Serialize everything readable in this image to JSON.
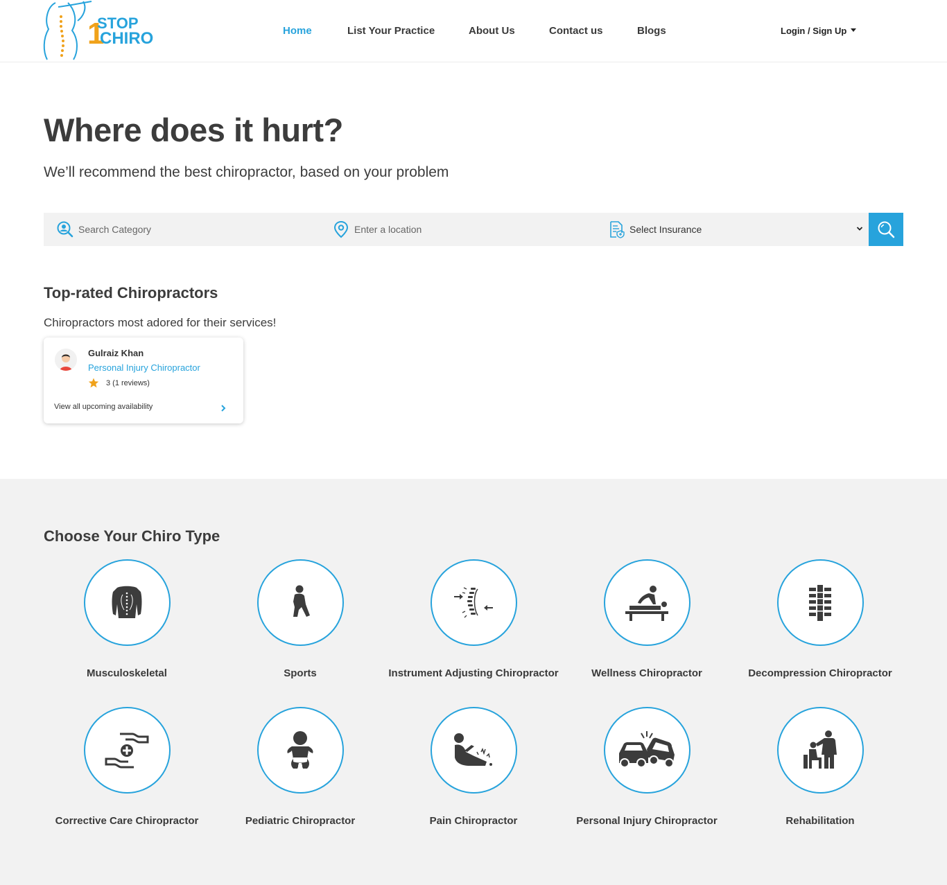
{
  "brand": {
    "logo_top": "STOP",
    "logo_bottom": "CHIRO",
    "logo_num": "1"
  },
  "nav": {
    "home": "Home",
    "list_practice": "List Your Practice",
    "about": "About Us",
    "contact": "Contact us",
    "blogs": "Blogs",
    "login": "Login / Sign Up"
  },
  "hero": {
    "title": "Where does it hurt?",
    "subtitle": "We’ll recommend the best chiropractor, based on your problem"
  },
  "search": {
    "category_placeholder": "Search Category",
    "location_placeholder": "Enter a location",
    "insurance_selected": "Select Insurance"
  },
  "top_rated": {
    "title": "Top-rated Chiropractors",
    "subtitle": "Chiropractors most adored for their services!",
    "cards": [
      {
        "name": "Gulraiz Khan",
        "specialty": "Personal Injury Chiropractor",
        "rating": "3 (1 reviews)",
        "availability": "View all upcoming availability"
      }
    ]
  },
  "chiro_types": {
    "title": "Choose Your Chiro Type",
    "items": [
      {
        "label": "Musculoskeletal",
        "icon": "back-muscles-icon"
      },
      {
        "label": "Sports",
        "icon": "athlete-icon"
      },
      {
        "label": "Instrument Adjusting Chiropractor",
        "icon": "spine-adjust-icon"
      },
      {
        "label": "Wellness Chiropractor",
        "icon": "massage-table-icon"
      },
      {
        "label": "Decompression Chiropractor",
        "icon": "spine-column-icon"
      },
      {
        "label": "Corrective Care Chiropractor",
        "icon": "care-hands-icon"
      },
      {
        "label": "Pediatric Chiropractor",
        "icon": "baby-icon"
      },
      {
        "label": "Pain Chiropractor",
        "icon": "leg-pain-icon"
      },
      {
        "label": "Personal Injury Chiropractor",
        "icon": "car-crash-icon"
      },
      {
        "label": "Rehabilitation",
        "icon": "rehab-icon"
      }
    ]
  },
  "colors": {
    "accent": "#27a3dc",
    "brand_orange": "#f0a21b",
    "icon_dark": "#3c3c3c",
    "section_bg": "#f2f2f2"
  }
}
